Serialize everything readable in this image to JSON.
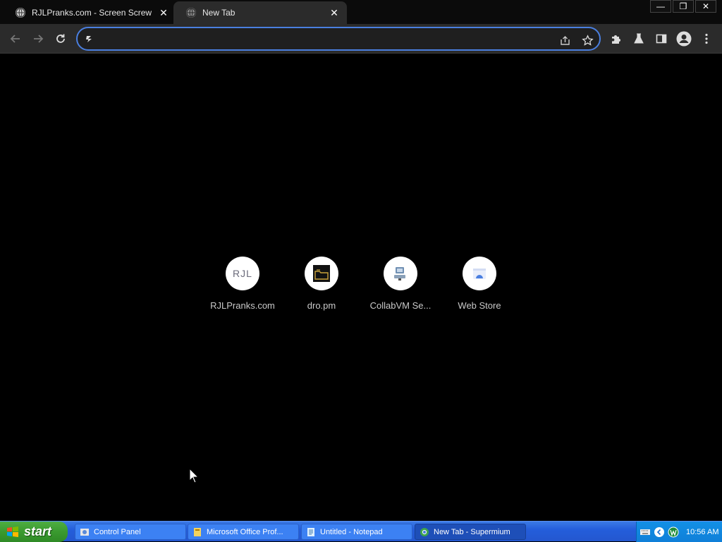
{
  "browser": {
    "tabs": [
      {
        "title": "RJLPranks.com - Screen Screw",
        "active": false
      },
      {
        "title": "New Tab",
        "active": true
      }
    ],
    "close_symbol": "✕",
    "window_controls": {
      "minimize": "—",
      "restore": "❐",
      "close": "✕"
    },
    "omnibox": {
      "value": "",
      "placeholder": ""
    }
  },
  "new_tab": {
    "shortcuts": [
      {
        "label": "RJLPranks.com",
        "icon_text": "RJL",
        "icon": "rjl-logo-icon"
      },
      {
        "label": "dro.pm",
        "icon": "dro-pm-icon"
      },
      {
        "label": "CollabVM Se...",
        "icon": "collabvm-icon"
      },
      {
        "label": "Web Store",
        "icon": "web-store-icon"
      }
    ]
  },
  "taskbar": {
    "start_label": "start",
    "tasks": [
      {
        "label": "Control Panel",
        "active": false
      },
      {
        "label": "Microsoft Office Prof...",
        "active": false
      },
      {
        "label": "Untitled - Notepad",
        "active": false
      },
      {
        "label": "New Tab - Supermium",
        "active": true
      }
    ],
    "clock": "10:56 AM"
  },
  "colors": {
    "accent": "#4a7fe0",
    "toolbar": "#2b2b2b",
    "taskbar": "#245edb",
    "start": "#3a9a2f"
  }
}
